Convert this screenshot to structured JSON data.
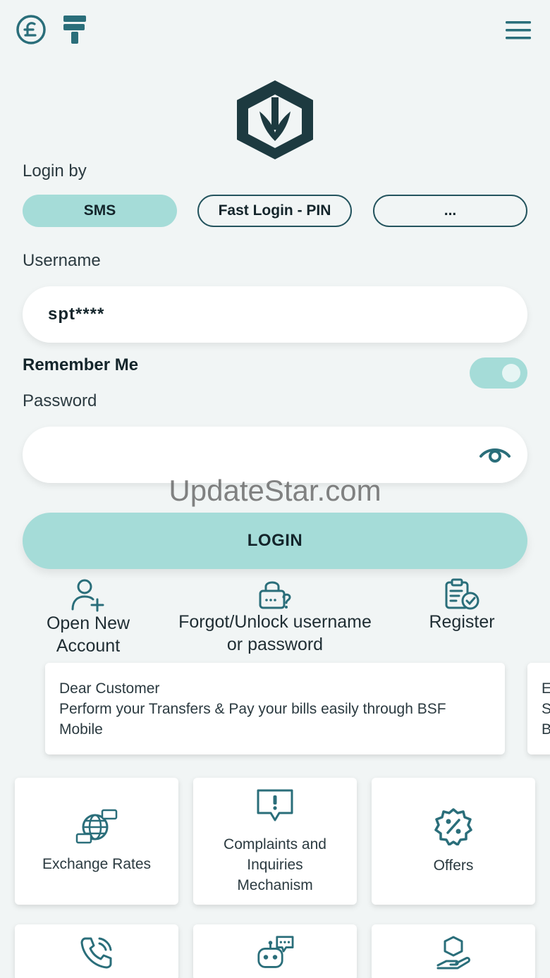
{
  "topbar": {
    "currency_icon": "pound-coin-icon",
    "brush_icon": "paint-roller-icon",
    "menu_icon": "hamburger-menu-icon"
  },
  "brand_logo": "bsf-logo-icon",
  "login_by": {
    "label": "Login by",
    "options": [
      "SMS",
      "Fast Login - PIN",
      "..."
    ],
    "selected": "SMS"
  },
  "username": {
    "label": "Username",
    "value": "spt****"
  },
  "remember_me": {
    "label": "Remember Me",
    "enabled": true
  },
  "password": {
    "label": "Password",
    "value": "",
    "toggle_icon": "eye-icon"
  },
  "login_button": "LOGIN",
  "watermark": "UpdateStar.com",
  "quick_links": [
    {
      "label_line1": "Open New",
      "label_line2": "Account",
      "icon": "add-user-icon"
    },
    {
      "label_line1": "Forgot/Unlock username",
      "label_line2": "or password",
      "icon": "lock-question-icon"
    },
    {
      "label_line1": "Register",
      "label_line2": "",
      "icon": "clipboard-check-icon"
    }
  ],
  "notice": {
    "line1": "Dear Customer",
    "line2": "Perform your Transfers & Pay your bills easily through BSF Mobile",
    "peek": "E S B"
  },
  "tiles": [
    {
      "label": "Exchange Rates",
      "icon": "exchange-globe-icon"
    },
    {
      "label_line1": "Complaints and",
      "label_line2": "Inquiries",
      "label_line3": "Mechanism",
      "icon": "alert-chat-icon"
    },
    {
      "label": "Offers",
      "icon": "percent-badge-icon"
    },
    {
      "label": "",
      "icon": "phone-call-icon"
    },
    {
      "label": "",
      "icon": "chatbot-icon"
    },
    {
      "label": "",
      "icon": "hand-box-icon"
    }
  ],
  "colors": {
    "accent": "#a5dcd8",
    "icon": "#2a6e7a",
    "background": "#f1f5f5",
    "dark": "#14252b"
  }
}
